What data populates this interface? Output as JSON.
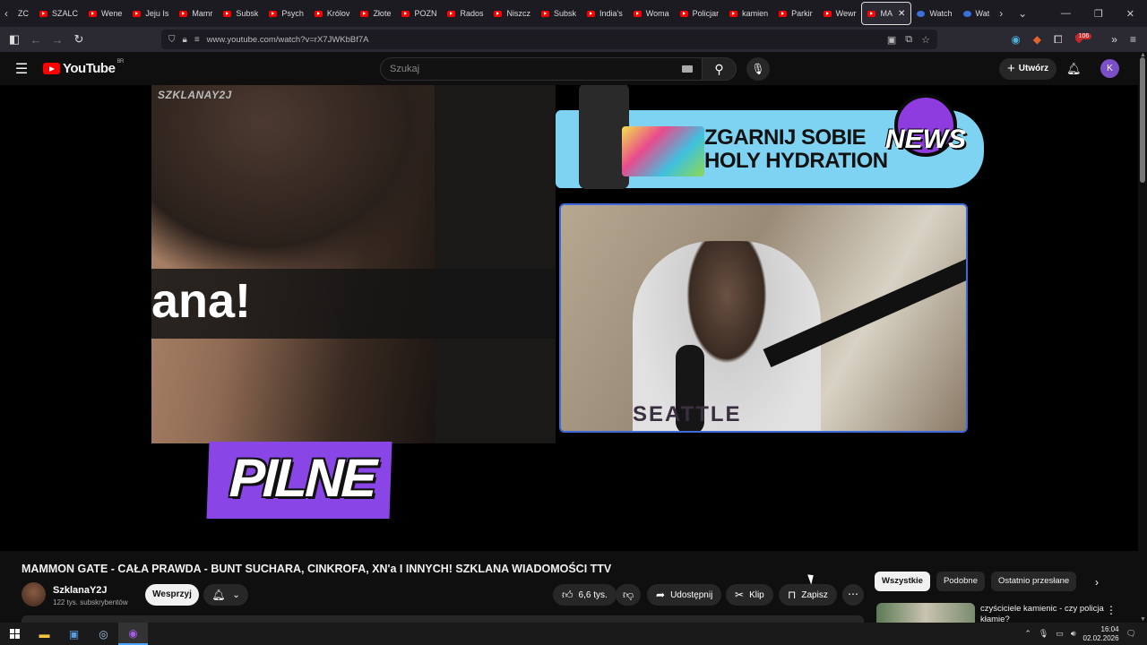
{
  "browser": {
    "tabs": [
      {
        "label": "ZC"
      },
      {
        "label": "SZALC"
      },
      {
        "label": "Wene"
      },
      {
        "label": "Jeju Is"
      },
      {
        "label": "Mamr"
      },
      {
        "label": "Subsk"
      },
      {
        "label": "Psych"
      },
      {
        "label": "Królov"
      },
      {
        "label": "Złote"
      },
      {
        "label": "POZN"
      },
      {
        "label": "Rados"
      },
      {
        "label": "Niszcz"
      },
      {
        "label": "Subsk"
      },
      {
        "label": "India's"
      },
      {
        "label": "Woma"
      },
      {
        "label": "Policjar"
      },
      {
        "label": "kamien"
      },
      {
        "label": "Parkir"
      },
      {
        "label": "Wewr"
      },
      {
        "label": "MA"
      },
      {
        "label": "Watch"
      },
      {
        "label": "Wat"
      }
    ],
    "url": "www.youtube.com/watch?v=rX7JWKbBf7A",
    "extension_badge": "106"
  },
  "youtube": {
    "logo_text": "YouTube",
    "logo_region": "BR",
    "search_placeholder": "Szukaj",
    "create_label": "Utwórz",
    "avatar_letter": "K"
  },
  "video": {
    "watermark": "SZKLANAY2J",
    "overlay_text": "ana!",
    "ad_text_line1": "ZGARNIJ SOBIE",
    "ad_text_line2": "HOLY HYDRATION",
    "ad_brand": "NEWS",
    "shirt_text": "SEATTLE",
    "banner_text": "PILNE"
  },
  "meta": {
    "title": "MAMMON GATE - CAŁA PRAWDA - BUNT SUCHARA, CINKROFA, XN'a I INNYCH! SZKLANA WIADOMOŚCI TTV",
    "channel_name": "SzklanaY2J",
    "channel_subs": "122 tys. subskrybentów",
    "support_label": "Wesprzyj",
    "likes": "6,6 tys.",
    "share_label": "Udostępnij",
    "clip_label": "Klip",
    "save_label": "Zapisz"
  },
  "sidebar": {
    "chips": [
      {
        "label": "Wszystkie",
        "active": true
      },
      {
        "label": "Podobne",
        "active": false
      },
      {
        "label": "Ostatnio przesłane",
        "active": false
      }
    ],
    "recommendation_title": "czyściciele kamienic - czy policja kłamie?"
  },
  "taskbar": {
    "time": "16:04",
    "date": "02.02.2026"
  },
  "colors": {
    "brand_red": "#ff0000",
    "banner_purple": "#8a45e6",
    "ad_blue": "#7fd3f2",
    "avatar_purple": "#7b4fc7"
  }
}
